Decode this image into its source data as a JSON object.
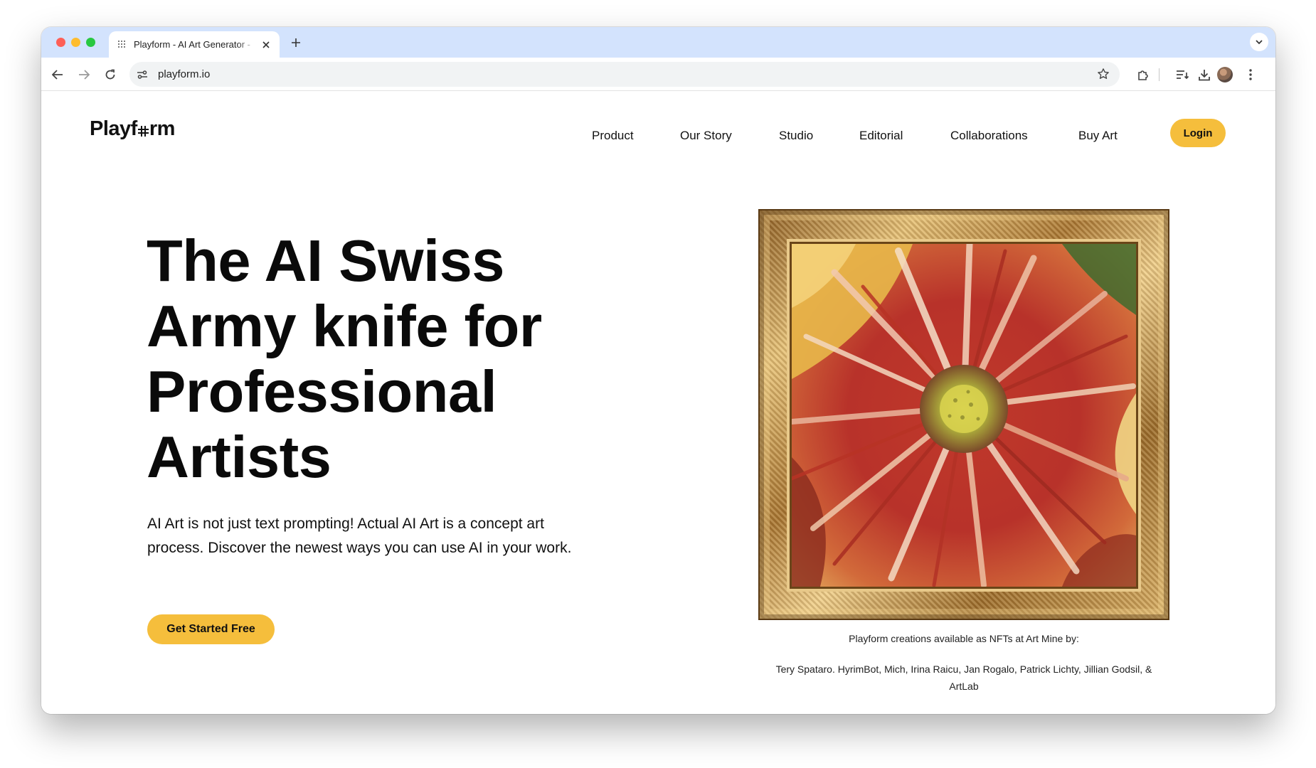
{
  "browser": {
    "tab_title": "Playform - AI Art Generator -",
    "url": "playform.io",
    "icons": [
      "close-icon",
      "plus-icon",
      "chevron-down-icon",
      "back-icon",
      "forward-icon",
      "reload-icon",
      "site-info-icon",
      "star-icon",
      "extensions-icon",
      "reading-list-icon",
      "download-icon",
      "avatar",
      "more-icon"
    ]
  },
  "site": {
    "logo": {
      "before": "Playf",
      "after": "rm"
    },
    "nav": [
      "Product",
      "Our Story",
      "Studio",
      "Editorial",
      "Collaborations",
      "Buy Art"
    ],
    "login_label": "Login",
    "accent_color": "#f5be3c"
  },
  "hero": {
    "title_lines": [
      "The AI Swiss",
      "Army knife for",
      "Professional",
      "Artists"
    ],
    "subtitle_lines": [
      "AI Art is not just text prompting! Actual AI Art is a concept art",
      "process. Discover the newest ways you can use AI in your work."
    ],
    "cta_label": "Get Started Free"
  },
  "artwork": {
    "caption_heading": "Playform creations available as NFTs at Art Mine by:",
    "caption_artists": "Tery Spataro. HyrimBot, Mich, Irina Raicu, Jan Rogalo, Patrick Lichty, Jillian Godsil, & ArtLab"
  }
}
